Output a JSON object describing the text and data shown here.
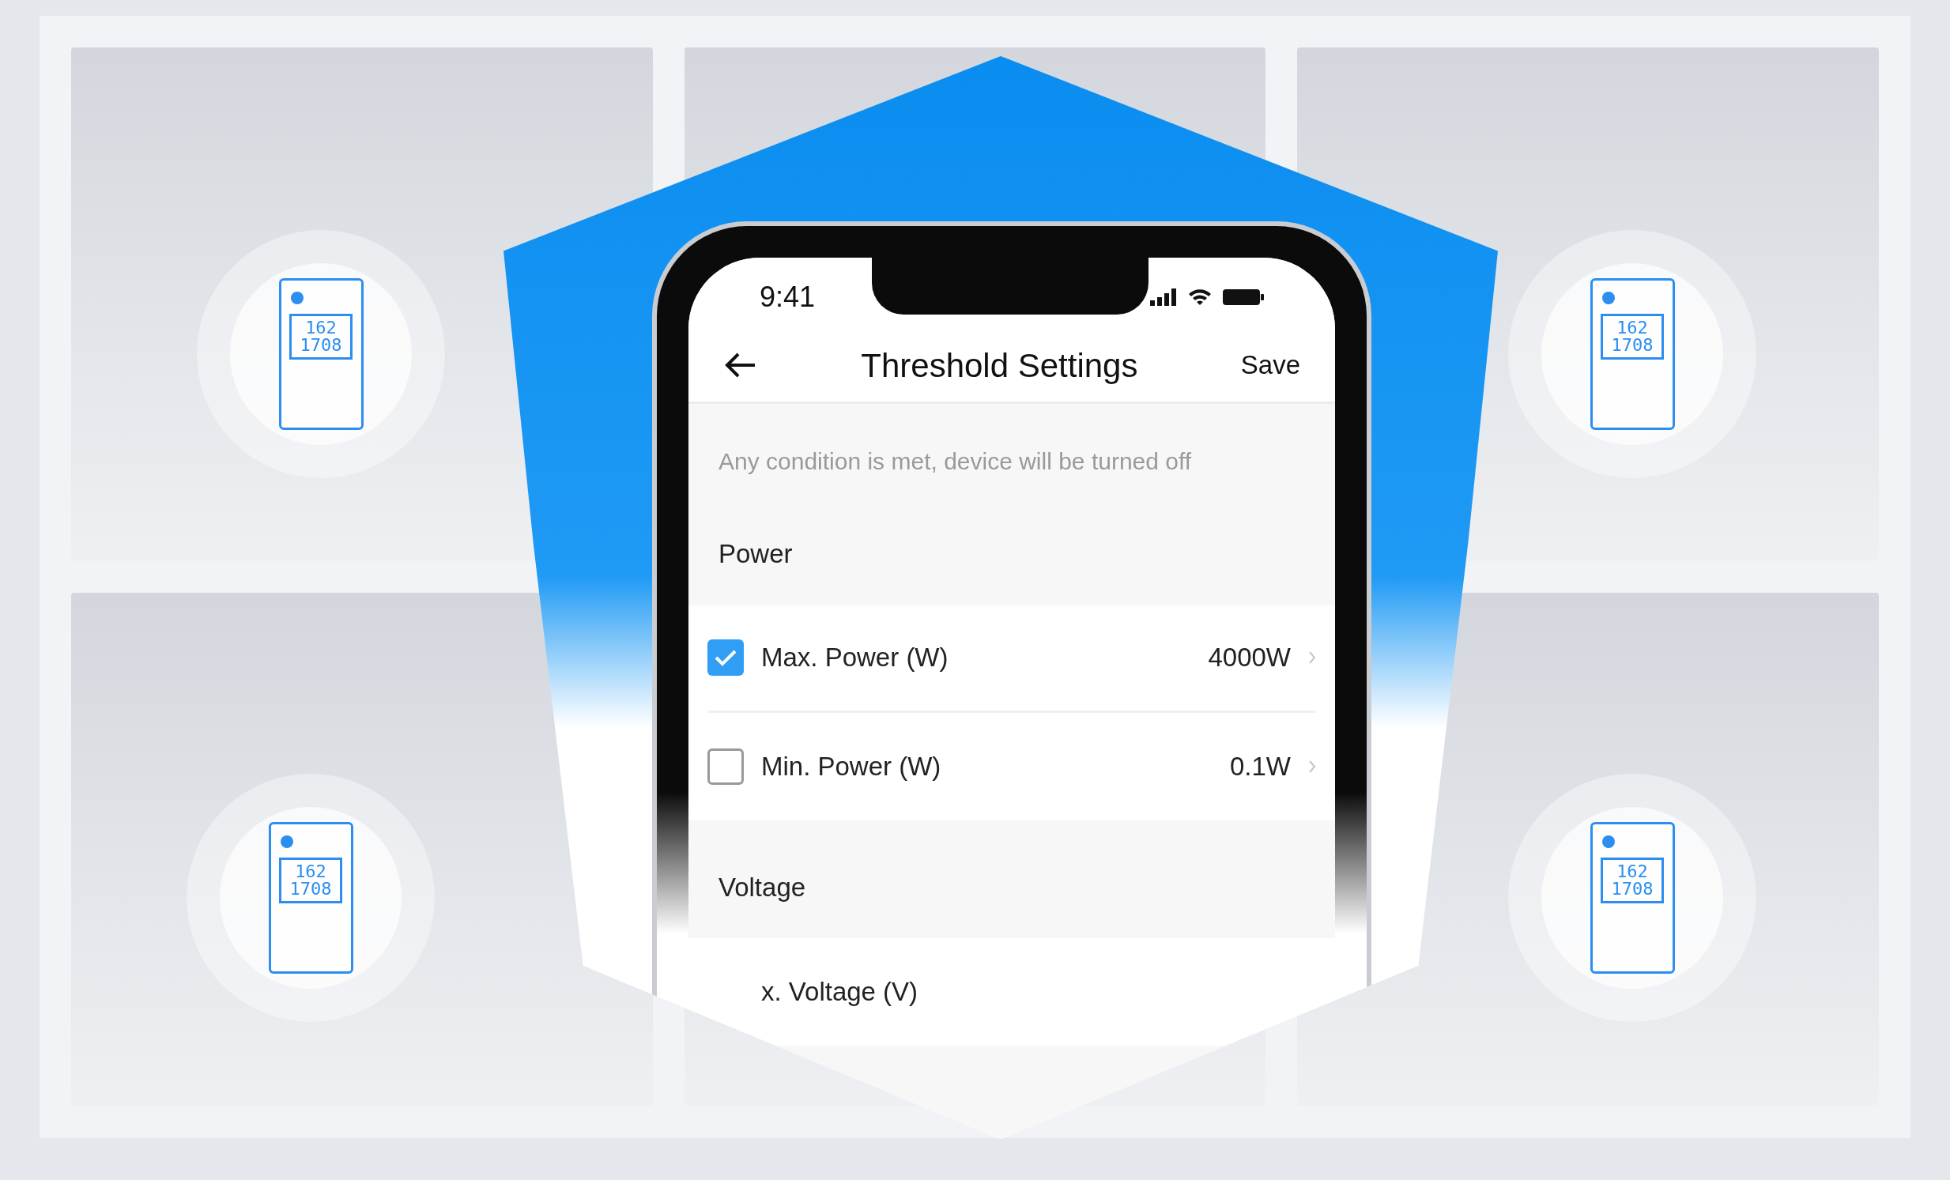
{
  "status_bar": {
    "time": "9:41"
  },
  "header": {
    "title": "Threshold Settings",
    "action": "Save"
  },
  "note": "Any condition is met, device will be turned off",
  "sections": [
    {
      "title": "Power",
      "rows": [
        {
          "label": "Max. Power (W)",
          "value": "4000W",
          "checked": true
        },
        {
          "label": "Min. Power (W)",
          "value": "0.1W",
          "checked": false
        }
      ]
    },
    {
      "title": "Voltage",
      "rows": [
        {
          "label": "x. Voltage (V)"
        }
      ]
    }
  ],
  "devices": [
    {
      "line_1": "162",
      "line_2": "1708"
    },
    {
      "line_1": "162",
      "line_2": "1708"
    },
    {
      "line_1": "162",
      "line_2": "1708"
    },
    {
      "line_1": "162",
      "line_2": "1708"
    }
  ]
}
